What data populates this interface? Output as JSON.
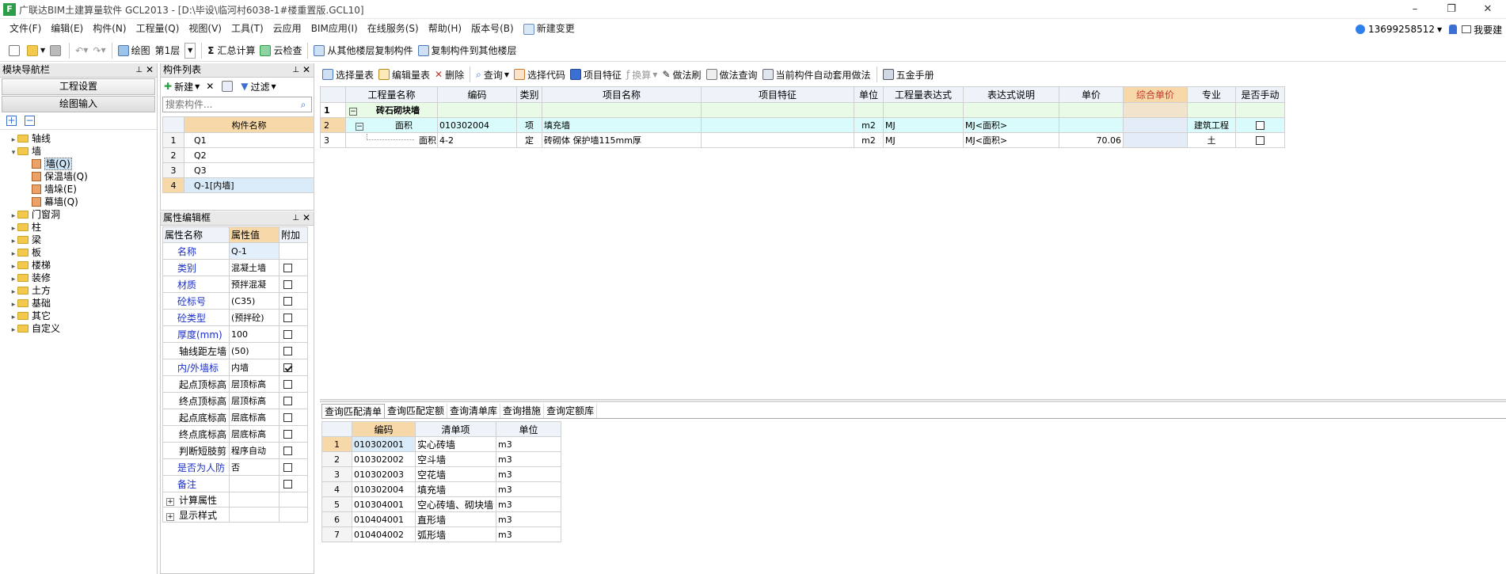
{
  "window": {
    "logo": "F",
    "title": "广联达BIM土建算量软件 GCL2013 - [D:\\毕设\\临河村6038-1#楼重置版.GCL10]",
    "min": "–",
    "max": "❐",
    "close": "✕"
  },
  "menu": [
    "文件(F)",
    "编辑(E)",
    "构件(N)",
    "工程量(Q)",
    "视图(V)",
    "工具(T)",
    "云应用",
    "BIM应用(I)",
    "在线服务(S)",
    "帮助(H)",
    "版本号(B)",
    "新建变更"
  ],
  "user": {
    "phone": "13699258512",
    "help": "我要建"
  },
  "toolbar1": {
    "draw": "绘图",
    "floor": "第1层",
    "sum": "汇总计算",
    "cloudcheck": "云检查",
    "copy_from": "从其他楼层复制构件",
    "copy_to": "复制构件到其他楼层"
  },
  "nav": {
    "title": "模块导航栏",
    "btn_project": "工程设置",
    "btn_draw": "绘图输入",
    "tree": [
      {
        "label": "轴线",
        "kind": "folder",
        "level": 0,
        "expanded": false
      },
      {
        "label": "墙",
        "kind": "folder",
        "level": 0,
        "expanded": true
      },
      {
        "label": "墙(Q)",
        "kind": "wall",
        "level": 1,
        "selected": true
      },
      {
        "label": "保温墙(Q)",
        "kind": "wall",
        "level": 1
      },
      {
        "label": "墙垛(E)",
        "kind": "wall",
        "level": 1
      },
      {
        "label": "幕墙(Q)",
        "kind": "wall",
        "level": 1
      },
      {
        "label": "门窗洞",
        "kind": "folder",
        "level": 0,
        "expanded": false
      },
      {
        "label": "柱",
        "kind": "folder",
        "level": 0,
        "expanded": false
      },
      {
        "label": "梁",
        "kind": "folder",
        "level": 0,
        "expanded": false
      },
      {
        "label": "板",
        "kind": "folder",
        "level": 0,
        "expanded": false
      },
      {
        "label": "楼梯",
        "kind": "folder",
        "level": 0,
        "expanded": false
      },
      {
        "label": "装修",
        "kind": "folder",
        "level": 0,
        "expanded": false
      },
      {
        "label": "土方",
        "kind": "folder",
        "level": 0,
        "expanded": false
      },
      {
        "label": "基础",
        "kind": "folder",
        "level": 0,
        "expanded": false
      },
      {
        "label": "其它",
        "kind": "folder",
        "level": 0,
        "expanded": false
      },
      {
        "label": "自定义",
        "kind": "folder",
        "level": 0,
        "expanded": false
      }
    ]
  },
  "comp": {
    "title": "构件列表",
    "new": "新建",
    "filter": "过滤",
    "search_placeholder": "搜索构件...",
    "col": "构件名称",
    "rows": [
      [
        "1",
        "Q1"
      ],
      [
        "2",
        "Q2"
      ],
      [
        "3",
        "Q3"
      ],
      [
        "4",
        "Q-1[内墙]"
      ]
    ]
  },
  "props": {
    "title": "属性编辑框",
    "headers": [
      "属性名称",
      "属性值",
      "附加"
    ],
    "rows": [
      {
        "name": "名称",
        "value": "Q-1",
        "blue": true,
        "cb": null
      },
      {
        "name": "类别",
        "value": "混凝土墙",
        "blue": true,
        "cb": false
      },
      {
        "name": "材质",
        "value": "预拌混凝",
        "blue": true,
        "cb": false
      },
      {
        "name": "砼标号",
        "value": "(C35)",
        "blue": true,
        "cb": false
      },
      {
        "name": "砼类型",
        "value": "(预拌砼)",
        "blue": true,
        "cb": false
      },
      {
        "name": "厚度(mm)",
        "value": "100",
        "blue": true,
        "cb": false
      },
      {
        "name": "轴线距左墙",
        "value": "(50)",
        "blue": false,
        "cb": false
      },
      {
        "name": "内/外墙标",
        "value": "内墙",
        "blue": true,
        "cb": true
      },
      {
        "name": "起点顶标高",
        "value": "层顶标高",
        "blue": false,
        "cb": false
      },
      {
        "name": "终点顶标高",
        "value": "层顶标高",
        "blue": false,
        "cb": false
      },
      {
        "name": "起点底标高",
        "value": "层底标高",
        "blue": false,
        "cb": false
      },
      {
        "name": "终点底标高",
        "value": "层底标高",
        "blue": false,
        "cb": false
      },
      {
        "name": "判断短肢剪",
        "value": "程序自动",
        "blue": false,
        "cb": false
      },
      {
        "name": "是否为人防",
        "value": "否",
        "blue": true,
        "cb": false
      },
      {
        "name": "备注",
        "value": "",
        "blue": true,
        "cb": false
      }
    ],
    "groups": [
      "计算属性",
      "显示样式"
    ]
  },
  "qtoolbar": [
    "选择量表",
    "编辑量表",
    "删除",
    "查询",
    "选择代码",
    "项目特征",
    "换算",
    "做法刷",
    "做法查询",
    "当前构件自动套用做法",
    "五金手册"
  ],
  "main_table": {
    "headers": [
      "",
      "工程量名称",
      "编码",
      "类别",
      "项目名称",
      "项目特征",
      "单位",
      "工程量表达式",
      "表达式说明",
      "单价",
      "综合单价",
      "专业",
      "是否手动"
    ],
    "rows": [
      {
        "no": "1",
        "name": "砖石砌块墙",
        "code": "",
        "type": "",
        "item": "",
        "feat": "",
        "unit": "",
        "expr": "",
        "desc": "",
        "price": "",
        "comp": "",
        "major": "",
        "manual": null,
        "kind": "group"
      },
      {
        "no": "2",
        "name": "面积",
        "code": "010302004",
        "type": "项",
        "item": "填充墙",
        "feat": "",
        "unit": "m2",
        "expr": "MJ",
        "desc": "MJ<面积>",
        "price": "",
        "comp": "",
        "major": "建筑工程",
        "manual": false,
        "kind": "item"
      },
      {
        "no": "3",
        "name": "面积",
        "code": "4-2",
        "type": "定",
        "item": "砖砌体 保护墙115mm厚",
        "feat": "",
        "unit": "m2",
        "expr": "MJ",
        "desc": "MJ<面积>",
        "price": "70.06",
        "comp": "",
        "major": "土",
        "manual": false,
        "kind": "quota"
      }
    ]
  },
  "bottom": {
    "tabs": [
      "查询匹配清单",
      "查询匹配定额",
      "查询清单库",
      "查询措施",
      "查询定额库"
    ],
    "headers": [
      "",
      "编码",
      "清单项",
      "单位"
    ],
    "rows": [
      [
        "1",
        "010302001",
        "实心砖墙",
        "m3"
      ],
      [
        "2",
        "010302002",
        "空斗墙",
        "m3"
      ],
      [
        "3",
        "010302003",
        "空花墙",
        "m3"
      ],
      [
        "4",
        "010302004",
        "填充墙",
        "m3"
      ],
      [
        "5",
        "010304001",
        "空心砖墙、砌块墙",
        "m3"
      ],
      [
        "6",
        "010404001",
        "直形墙",
        "m3"
      ],
      [
        "7",
        "010404002",
        "弧形墙",
        "m3"
      ]
    ]
  }
}
